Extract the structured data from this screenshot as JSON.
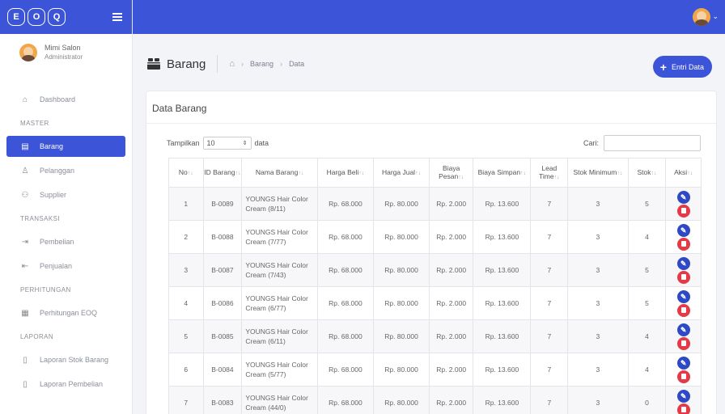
{
  "brand": {
    "letters": [
      "E",
      "O",
      "Q"
    ]
  },
  "user": {
    "name": "Mimi Salon",
    "role": "Administrator"
  },
  "nav": {
    "dashboard": "Dashboard",
    "master": "MASTER",
    "barang": "Barang",
    "pelanggan": "Pelanggan",
    "supplier": "Supplier",
    "transaksi": "TRANSAKSI",
    "pembelian": "Pembelian",
    "penjualan": "Penjualan",
    "perhitungan": "PERHITUNGAN",
    "perhitungan_eoq": "Perhitungan EOQ",
    "laporan": "LAPORAN",
    "laporan_stok": "Laporan Stok Barang",
    "laporan_pembelian": "Laporan Pembelian"
  },
  "header": {
    "title": "Barang",
    "crumb_1": "Barang",
    "crumb_2": "Data",
    "entri_label": "Entri Data"
  },
  "card": {
    "title": "Data Barang"
  },
  "controls": {
    "show_label": "Tampilkan",
    "show_value": "10",
    "data_label": "data",
    "search_label": "Cari:"
  },
  "table": {
    "columns": [
      "No",
      "ID Barang",
      "Nama Barang",
      "Harga Beli",
      "Harga Jual",
      "Biaya Pesan",
      "Biaya Simpan",
      "Lead Time",
      "Stok Minimum",
      "Stok",
      "Aksi"
    ],
    "rows": [
      [
        "1",
        "B-0089",
        "YOUNGS Hair Color Cream (8/11)",
        "Rp. 68.000",
        "Rp. 80.000",
        "Rp. 2.000",
        "Rp. 13.600",
        "7",
        "3",
        "5"
      ],
      [
        "2",
        "B-0088",
        "YOUNGS Hair Color Cream (7/77)",
        "Rp. 68.000",
        "Rp. 80.000",
        "Rp. 2.000",
        "Rp. 13.600",
        "7",
        "3",
        "4"
      ],
      [
        "3",
        "B-0087",
        "YOUNGS Hair Color Cream (7/43)",
        "Rp. 68.000",
        "Rp. 80.000",
        "Rp. 2.000",
        "Rp. 13.600",
        "7",
        "3",
        "5"
      ],
      [
        "4",
        "B-0086",
        "YOUNGS Hair Color Cream (6/77)",
        "Rp. 68.000",
        "Rp. 80.000",
        "Rp. 2.000",
        "Rp. 13.600",
        "7",
        "3",
        "5"
      ],
      [
        "5",
        "B-0085",
        "YOUNGS Hair Color Cream (6/11)",
        "Rp. 68.000",
        "Rp. 80.000",
        "Rp. 2.000",
        "Rp. 13.600",
        "7",
        "3",
        "4"
      ],
      [
        "6",
        "B-0084",
        "YOUNGS Hair Color Cream (5/77)",
        "Rp. 68.000",
        "Rp. 80.000",
        "Rp. 2.000",
        "Rp. 13.600",
        "7",
        "3",
        "4"
      ],
      [
        "7",
        "B-0083",
        "YOUNGS Hair Color Cream (44/0)",
        "Rp. 68.000",
        "Rp. 80.000",
        "Rp. 2.000",
        "Rp. 13.600",
        "7",
        "3",
        "0"
      ]
    ]
  },
  "colors": {
    "primary": "#3b54d8",
    "edit": "#2d49c6",
    "delete": "#e63946"
  }
}
